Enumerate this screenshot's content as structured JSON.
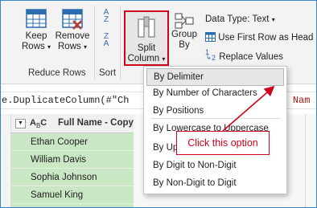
{
  "ribbon": {
    "keep_rows": {
      "line1": "Keep",
      "line2": "Rows"
    },
    "remove_rows": {
      "line1": "Remove",
      "line2": "Rows"
    },
    "reduce_rows_label": "Reduce Rows",
    "sort_label": "Sort",
    "sort_az": {
      "top": "A",
      "bottom": "Z"
    },
    "sort_za": {
      "top": "Z",
      "bottom": "A"
    },
    "split_column": {
      "line1": "Split",
      "line2": "Column"
    },
    "group_by": {
      "line1": "Group",
      "line2": "By"
    },
    "data_type": "Data Type: Text",
    "first_row_headers": "Use First Row as Head",
    "replace_values": "Replace Values",
    "replace_icon_digits": {
      "one": "1",
      "two": "2"
    }
  },
  "formula": {
    "prefix": "e.DuplicateColumn(#\"Ch",
    "suffix": "1 Nam"
  },
  "column": {
    "type_glyph": "A",
    "type_sub": "B",
    "type_suffix": "C",
    "header": "Full Name - Copy",
    "rows": [
      "Ethan Cooper",
      "William Davis",
      "Sophia Johnson",
      "Samuel King"
    ]
  },
  "menu": {
    "items": [
      "By Delimiter",
      "By Number of Characters",
      "By Positions",
      "By Lowercase to Uppercase",
      "By Uppercase to Lowercase",
      "By Digit to Non-Digit",
      "By Non-Digit to Digit"
    ],
    "highlighted_index": 0
  },
  "annotation": {
    "callout_text": "Click this option",
    "color": "#d0021b"
  },
  "colors": {
    "accent_red": "#d0021b",
    "column_highlight": "#c9e7c4",
    "icon_blue": "#2b6cb0",
    "icon_red": "#c0392b"
  }
}
